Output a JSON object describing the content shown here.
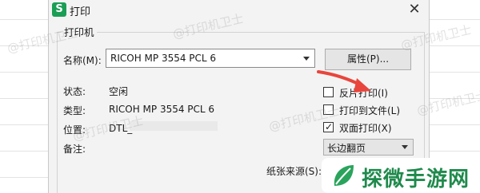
{
  "window": {
    "app_icon_letter": "S",
    "title": "打印",
    "close_glyph": "✕"
  },
  "printer": {
    "group_label": "打印机",
    "name_label": "名称(M):",
    "selected_printer": "RICOH MP 3554 PCL 6",
    "properties_button": "属性(P)...",
    "status_label": "状态:",
    "status_value": "空闲",
    "type_label": "类型:",
    "type_value": "RICOH MP 3554 PCL 6",
    "location_label": "位置:",
    "location_value": "DTL_",
    "comment_label": "备注:",
    "paper_source_label": "纸张来源(S):"
  },
  "options": {
    "reverse_print": {
      "label": "反片打印(I)",
      "checked": false
    },
    "print_to_file": {
      "label": "打印到文件(L)",
      "checked": false
    },
    "duplex": {
      "label": "双面打印(X)",
      "checked": true
    },
    "duplex_mode": "长边翻页",
    "check_glyph": "✓"
  },
  "overlay": {
    "watermark_text": "@打印机卫士",
    "logo_text": "探微手游网",
    "arrow_color": "#e8453c",
    "accent_green": "#1f8a4c"
  }
}
